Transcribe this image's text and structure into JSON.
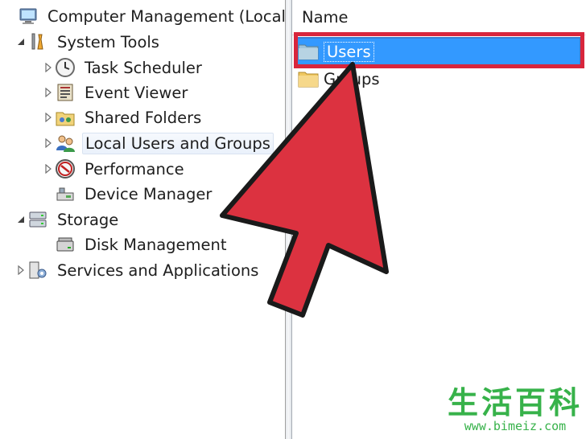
{
  "tree": {
    "items": [
      {
        "label": "Computer Management (Local)",
        "icon": "computer-management-icon",
        "expander": "none"
      },
      {
        "label": "System Tools",
        "icon": "system-tools-icon",
        "expander": "expanded"
      },
      {
        "label": "Task Scheduler",
        "icon": "task-scheduler-icon",
        "expander": "collapsed"
      },
      {
        "label": "Event Viewer",
        "icon": "event-viewer-icon",
        "expander": "collapsed"
      },
      {
        "label": "Shared Folders",
        "icon": "shared-folders-icon",
        "expander": "collapsed"
      },
      {
        "label": "Local Users and Groups",
        "icon": "local-users-groups-icon",
        "expander": "collapsed"
      },
      {
        "label": "Performance",
        "icon": "performance-icon",
        "expander": "collapsed"
      },
      {
        "label": "Device Manager",
        "icon": "device-manager-icon",
        "expander": "none"
      },
      {
        "label": "Storage",
        "icon": "storage-icon",
        "expander": "expanded"
      },
      {
        "label": "Disk Management",
        "icon": "disk-management-icon",
        "expander": "none"
      },
      {
        "label": "Services and Applications",
        "icon": "services-applications-icon",
        "expander": "collapsed"
      }
    ]
  },
  "list": {
    "column_header": "Name",
    "rows": [
      {
        "label": "Users",
        "icon": "folder-icon",
        "selected": true
      },
      {
        "label": "Groups",
        "icon": "folder-icon",
        "selected": false
      }
    ]
  },
  "annotation": {
    "highlight_color": "#d8263c",
    "arrow_color": "#d8263c"
  },
  "watermark": {
    "text": "生活百科",
    "url": "www.bimeiz.com"
  },
  "colors": {
    "selection": "#3399ff",
    "watermark": "#37b24a"
  }
}
